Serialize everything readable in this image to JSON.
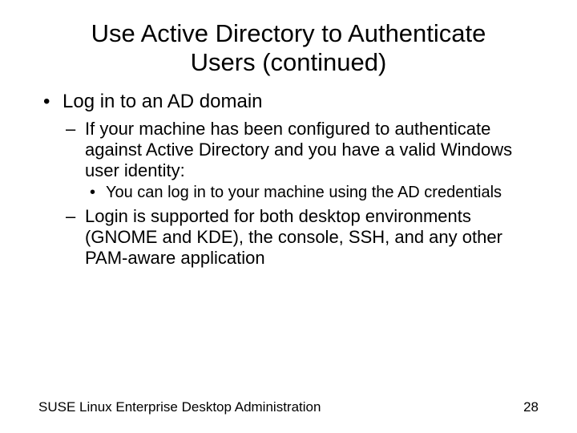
{
  "title_line1": "Use Active Directory to Authenticate",
  "title_line2": "Users (continued)",
  "bullets": {
    "b1": "Log in to an AD domain",
    "b1_1": "If your machine has been configured to authenticate against Active Directory and you have a valid Windows user identity:",
    "b1_1_1": "You can log in to your machine using the AD credentials",
    "b1_2": "Login is supported for both desktop environments (GNOME and KDE), the console, SSH, and any other PAM-aware application"
  },
  "footer": {
    "left": "SUSE Linux Enterprise Desktop Administration",
    "right": "28"
  }
}
